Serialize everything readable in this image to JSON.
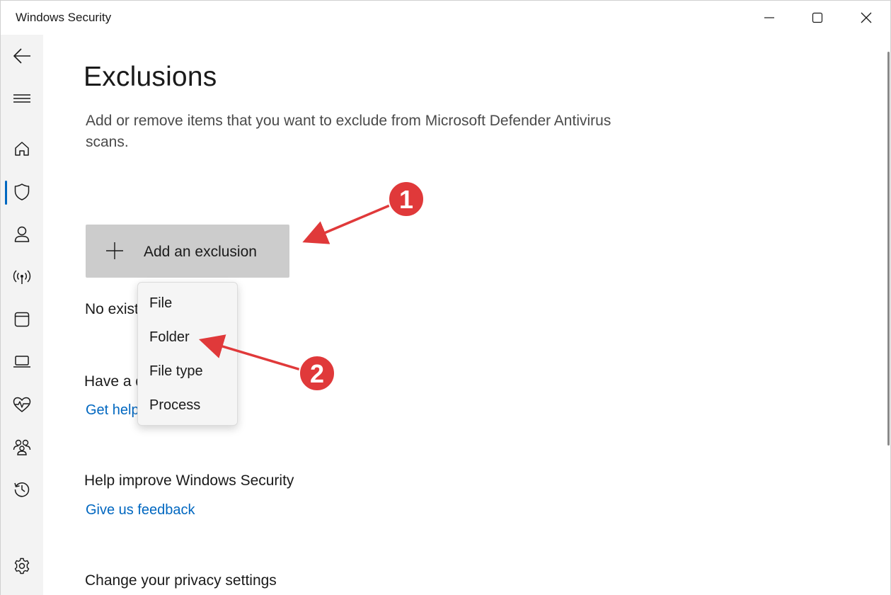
{
  "window": {
    "title": "Windows Security"
  },
  "page": {
    "title": "Exclusions",
    "description": "Add or remove items that you want to exclude from Microsoft Defender Antivirus scans.",
    "add_button_label": "Add an exclusion",
    "no_exclusions_text": "No existing exclusions.",
    "question_heading": "Have a question?",
    "get_help_link": "Get help",
    "help_improve_heading": "Help improve Windows Security",
    "feedback_link": "Give us feedback",
    "privacy_heading": "Change your privacy settings"
  },
  "menu": {
    "items": [
      "File",
      "Folder",
      "File type",
      "Process"
    ]
  },
  "sidebar": {
    "items": [
      "back-arrow-icon",
      "hamburger-menu-icon",
      "home-icon",
      "shield-icon",
      "account-icon",
      "wireless-icon",
      "app-browser-icon",
      "laptop-icon",
      "heart-pulse-icon",
      "family-icon",
      "history-icon",
      "settings-icon"
    ],
    "active_index": 3
  },
  "annotations": {
    "badge_1": "1",
    "badge_2": "2"
  },
  "colors": {
    "accent": "#0067c0",
    "annotation_red": "#e0393a",
    "button_bg": "#cccccc"
  }
}
